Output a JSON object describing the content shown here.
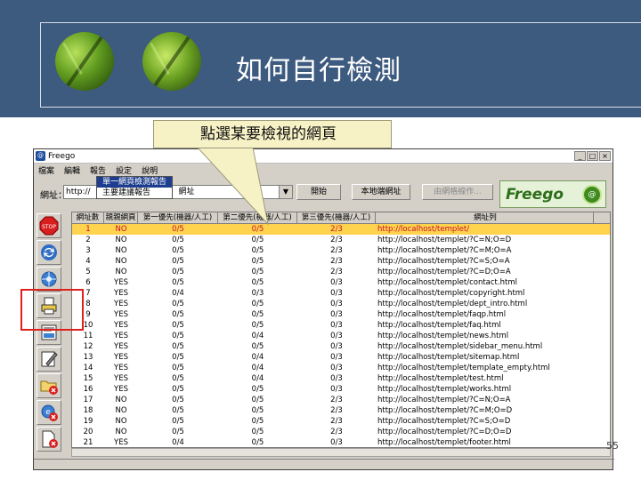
{
  "slide": {
    "title": "如何自行檢測",
    "callout": "點選某要檢視的網頁",
    "page_number": "55"
  },
  "window": {
    "title": "Freego",
    "controls": [
      "_",
      "□",
      "×"
    ]
  },
  "menu": {
    "items": [
      "檔案",
      "編輯",
      "報告",
      "設定",
      "說明"
    ],
    "dropdown": [
      "單一網頁檢測報告",
      "主要建議報告"
    ]
  },
  "address": {
    "label": "網址：",
    "value": "http://",
    "value_suffix": "網址"
  },
  "toolbar": {
    "buttons": [
      "開始",
      "本地端網址",
      "由網格線作..."
    ]
  },
  "logo": {
    "text": "Freego",
    "badge": "@"
  },
  "side_icons": [
    "stop-icon",
    "refresh-icon",
    "network-icon",
    "print-icon",
    "report-icon",
    "edit-icon",
    "folder-delete-icon",
    "browser-delete-icon",
    "file-delete-icon"
  ],
  "colors": {
    "header_bg": "#3d5a7f",
    "highlight_row": "#ffd34d",
    "highlight_text": "#c8102e",
    "annotation": "#e0201b"
  },
  "table": {
    "columns": [
      "網址數",
      "親親網頁",
      "第一優先(機器/人工)",
      "第二優先(機器/人工)",
      "第三優先(機器/人工)",
      "網址列"
    ],
    "rows": [
      [
        "1",
        "NO",
        "0/5",
        "0/5",
        "2/3",
        "http://localhost/templet/"
      ],
      [
        "2",
        "NO",
        "0/5",
        "0/5",
        "2/3",
        "http://localhost/templet/?C=N;O=D"
      ],
      [
        "3",
        "NO",
        "0/5",
        "0/5",
        "2/3",
        "http://localhost/templet/?C=M;O=A"
      ],
      [
        "4",
        "NO",
        "0/5",
        "0/5",
        "2/3",
        "http://localhost/templet/?C=S;O=A"
      ],
      [
        "5",
        "NO",
        "0/5",
        "0/5",
        "2/3",
        "http://localhost/templet/?C=D;O=A"
      ],
      [
        "6",
        "YES",
        "0/5",
        "0/5",
        "0/3",
        "http://localhost/templet/contact.html"
      ],
      [
        "7",
        "YES",
        "0/4",
        "0/3",
        "0/3",
        "http://localhost/templet/copyright.html"
      ],
      [
        "8",
        "YES",
        "0/5",
        "0/5",
        "0/3",
        "http://localhost/templet/dept_intro.html"
      ],
      [
        "9",
        "YES",
        "0/5",
        "0/5",
        "0/3",
        "http://localhost/templet/faqp.html"
      ],
      [
        "10",
        "YES",
        "0/5",
        "0/5",
        "0/3",
        "http://localhost/templet/faq.html"
      ],
      [
        "11",
        "YES",
        "0/5",
        "0/4",
        "0/3",
        "http://localhost/templet/news.html"
      ],
      [
        "12",
        "YES",
        "0/5",
        "0/5",
        "0/3",
        "http://localhost/templet/sidebar_menu.html"
      ],
      [
        "13",
        "YES",
        "0/5",
        "0/4",
        "0/3",
        "http://localhost/templet/sitemap.html"
      ],
      [
        "14",
        "YES",
        "0/5",
        "0/4",
        "0/3",
        "http://localhost/templet/template_empty.html"
      ],
      [
        "15",
        "YES",
        "0/5",
        "0/4",
        "0/3",
        "http://localhost/templet/test.html"
      ],
      [
        "16",
        "YES",
        "0/5",
        "0/5",
        "0/3",
        "http://localhost/templet/works.html"
      ],
      [
        "17",
        "NO",
        "0/5",
        "0/5",
        "2/3",
        "http://localhost/templet/?C=N;O=A"
      ],
      [
        "18",
        "NO",
        "0/5",
        "0/5",
        "2/3",
        "http://localhost/templet/?C=M;O=D"
      ],
      [
        "19",
        "NO",
        "0/5",
        "0/5",
        "2/3",
        "http://localhost/templet/?C=S;O=D"
      ],
      [
        "20",
        "NO",
        "0/5",
        "0/5",
        "2/3",
        "http://localhost/templet/?C=D;O=D"
      ],
      [
        "21",
        "YES",
        "0/4",
        "0/5",
        "0/3",
        "http://localhost/templet/footer.html"
      ]
    ],
    "highlight_index": 0
  }
}
